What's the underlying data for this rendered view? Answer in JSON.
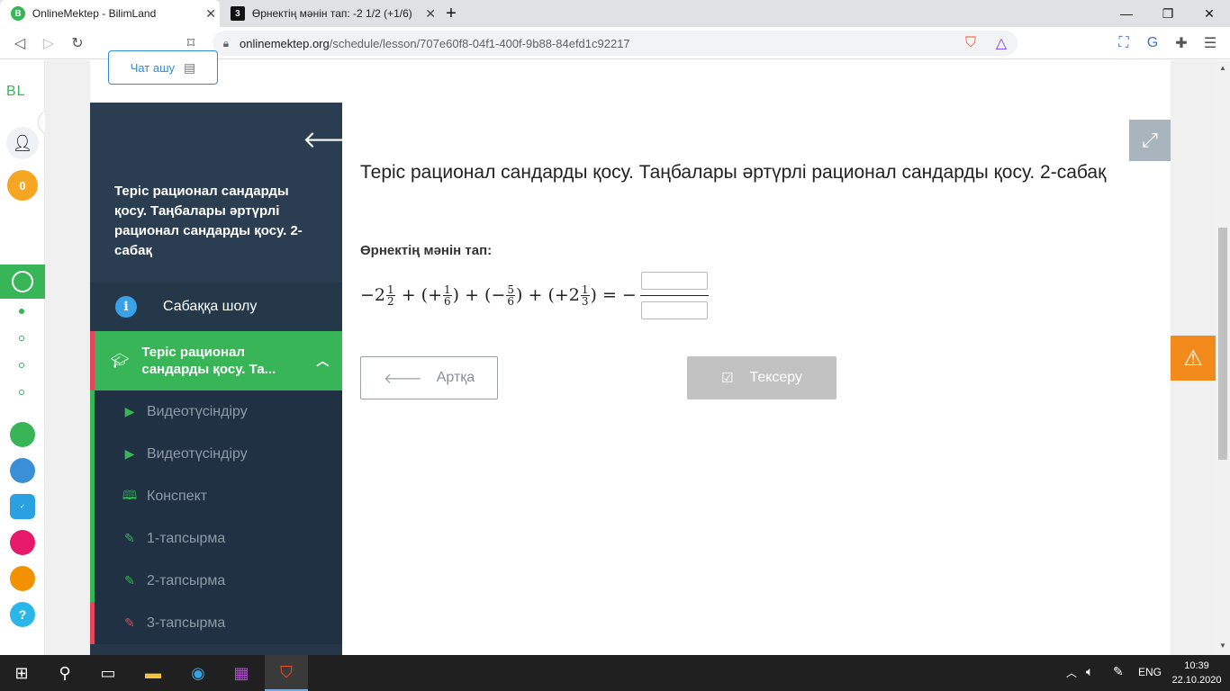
{
  "browser": {
    "tabs": [
      {
        "title": "OnlineMektep - BilimLand",
        "active": true,
        "favicon": "B"
      },
      {
        "title": "Өрнектің мәнін тап: -2 1/2 (+1/6)",
        "active": false,
        "favicon": "3"
      }
    ],
    "url_host": "onlinemektep.org",
    "url_path": "/schedule/lesson/707e60f8-04f1-400f-9b88-84efd1c92217"
  },
  "rail": {
    "logo": "BL",
    "points": "0"
  },
  "chat_button": {
    "label": "Чат ашу"
  },
  "sidebar": {
    "lesson_title": "Теріс рационал сандарды қосу. Таңбалары әртүрлі рационал сандарды қосу. 2-сабақ",
    "overview_label": "Сабаққа шолу",
    "active_section_label": "Теріс рационал сандарды қосу. Та...",
    "items": [
      {
        "label": "Видеотүсіндіру",
        "icon": "play-icon"
      },
      {
        "label": "Видеотүсіндіру",
        "icon": "play-icon"
      },
      {
        "label": "Конспект",
        "icon": "book-icon"
      },
      {
        "label": "1-тапсырма",
        "icon": "edit-icon"
      },
      {
        "label": "2-тапсырма",
        "icon": "edit-icon"
      },
      {
        "label": "3-тапсырма",
        "icon": "edit-icon"
      }
    ]
  },
  "main": {
    "lesson_title": "Теріс рационал сандарды қосу. Таңбалары әртүрлі рационал сандарды қосу. 2-сабақ",
    "task_label": "Өрнектің мәнін тап:",
    "answer_numerator": "",
    "answer_denominator": "",
    "back_button": "Артқа",
    "check_button": "Тексеру"
  },
  "taskbar": {
    "lang": "ENG",
    "time": "10:39",
    "date": "22.10.2020"
  },
  "colors": {
    "accent_green": "#37b557",
    "sidebar_bg": "#253748",
    "accent_blue": "#2f8bd8",
    "warning": "#f38a1c"
  }
}
